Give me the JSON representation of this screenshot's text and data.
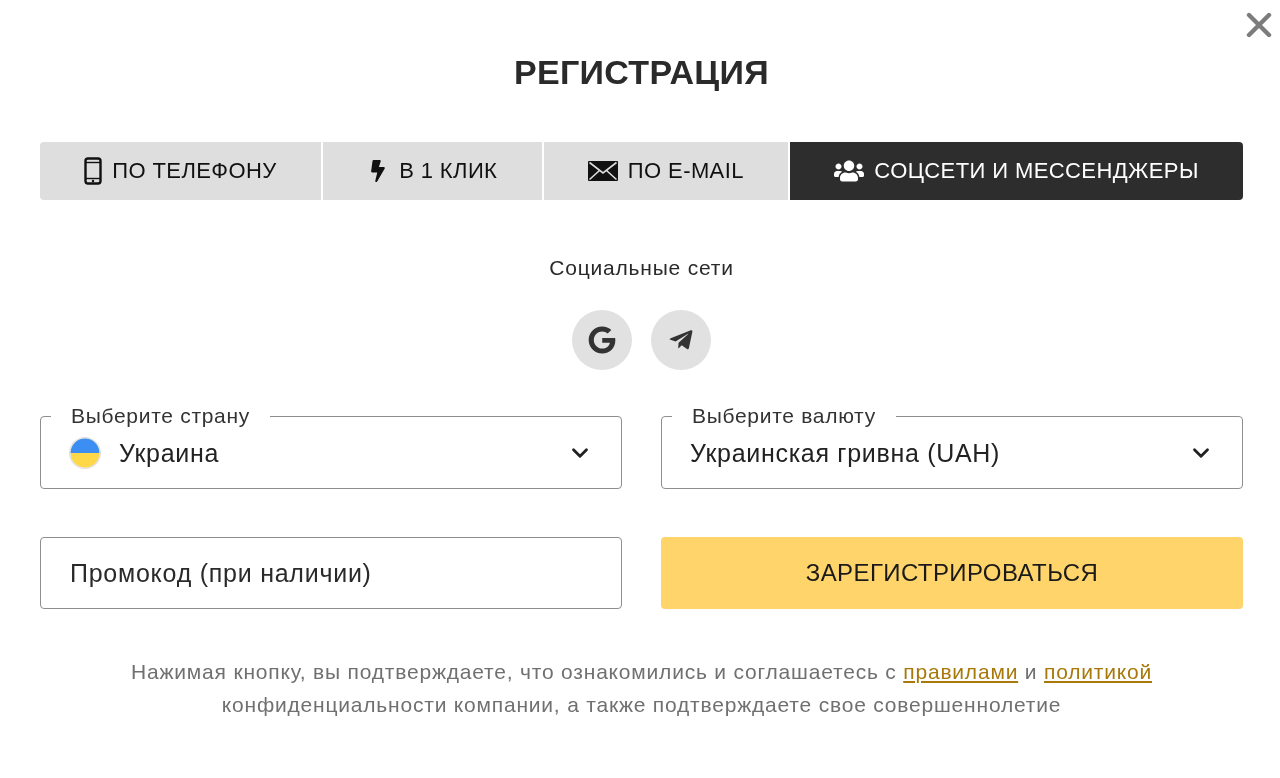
{
  "dialog": {
    "title": "РЕГИСТРАЦИЯ"
  },
  "tabs": [
    {
      "label": "ПО ТЕЛЕФОНУ",
      "selected": false
    },
    {
      "label": "В 1 КЛИК",
      "selected": false
    },
    {
      "label": "ПО E-MAIL",
      "selected": false
    },
    {
      "label": "СОЦСЕТИ И МЕССЕНДЖЕРЫ",
      "selected": true
    }
  ],
  "social": {
    "title": "Социальные сети"
  },
  "selects": [
    {
      "kind": "country",
      "label": "Выберите страну",
      "value": "Украина"
    },
    {
      "kind": "currency",
      "label": "Выберите валюту",
      "value": "Украинская гривна (UAH)"
    }
  ],
  "promo_field": {
    "placeholder": "Промокод (при наличии)"
  },
  "submit_button": {
    "label": "ЗАРЕГИСТРИРОВАТЬСЯ"
  },
  "consent": [
    {
      "kind": "text",
      "text": "Нажимая кнопку, вы подтверждаете, что ознакомились и соглашаетесь с "
    },
    {
      "kind": "link",
      "text": "правилами"
    },
    {
      "kind": "text",
      "text": " и "
    },
    {
      "kind": "link",
      "text": "политикой"
    },
    {
      "kind": "text",
      "text": " конфиденциальности компании, а также подтверждаете свое совершеннолетие"
    }
  ]
}
